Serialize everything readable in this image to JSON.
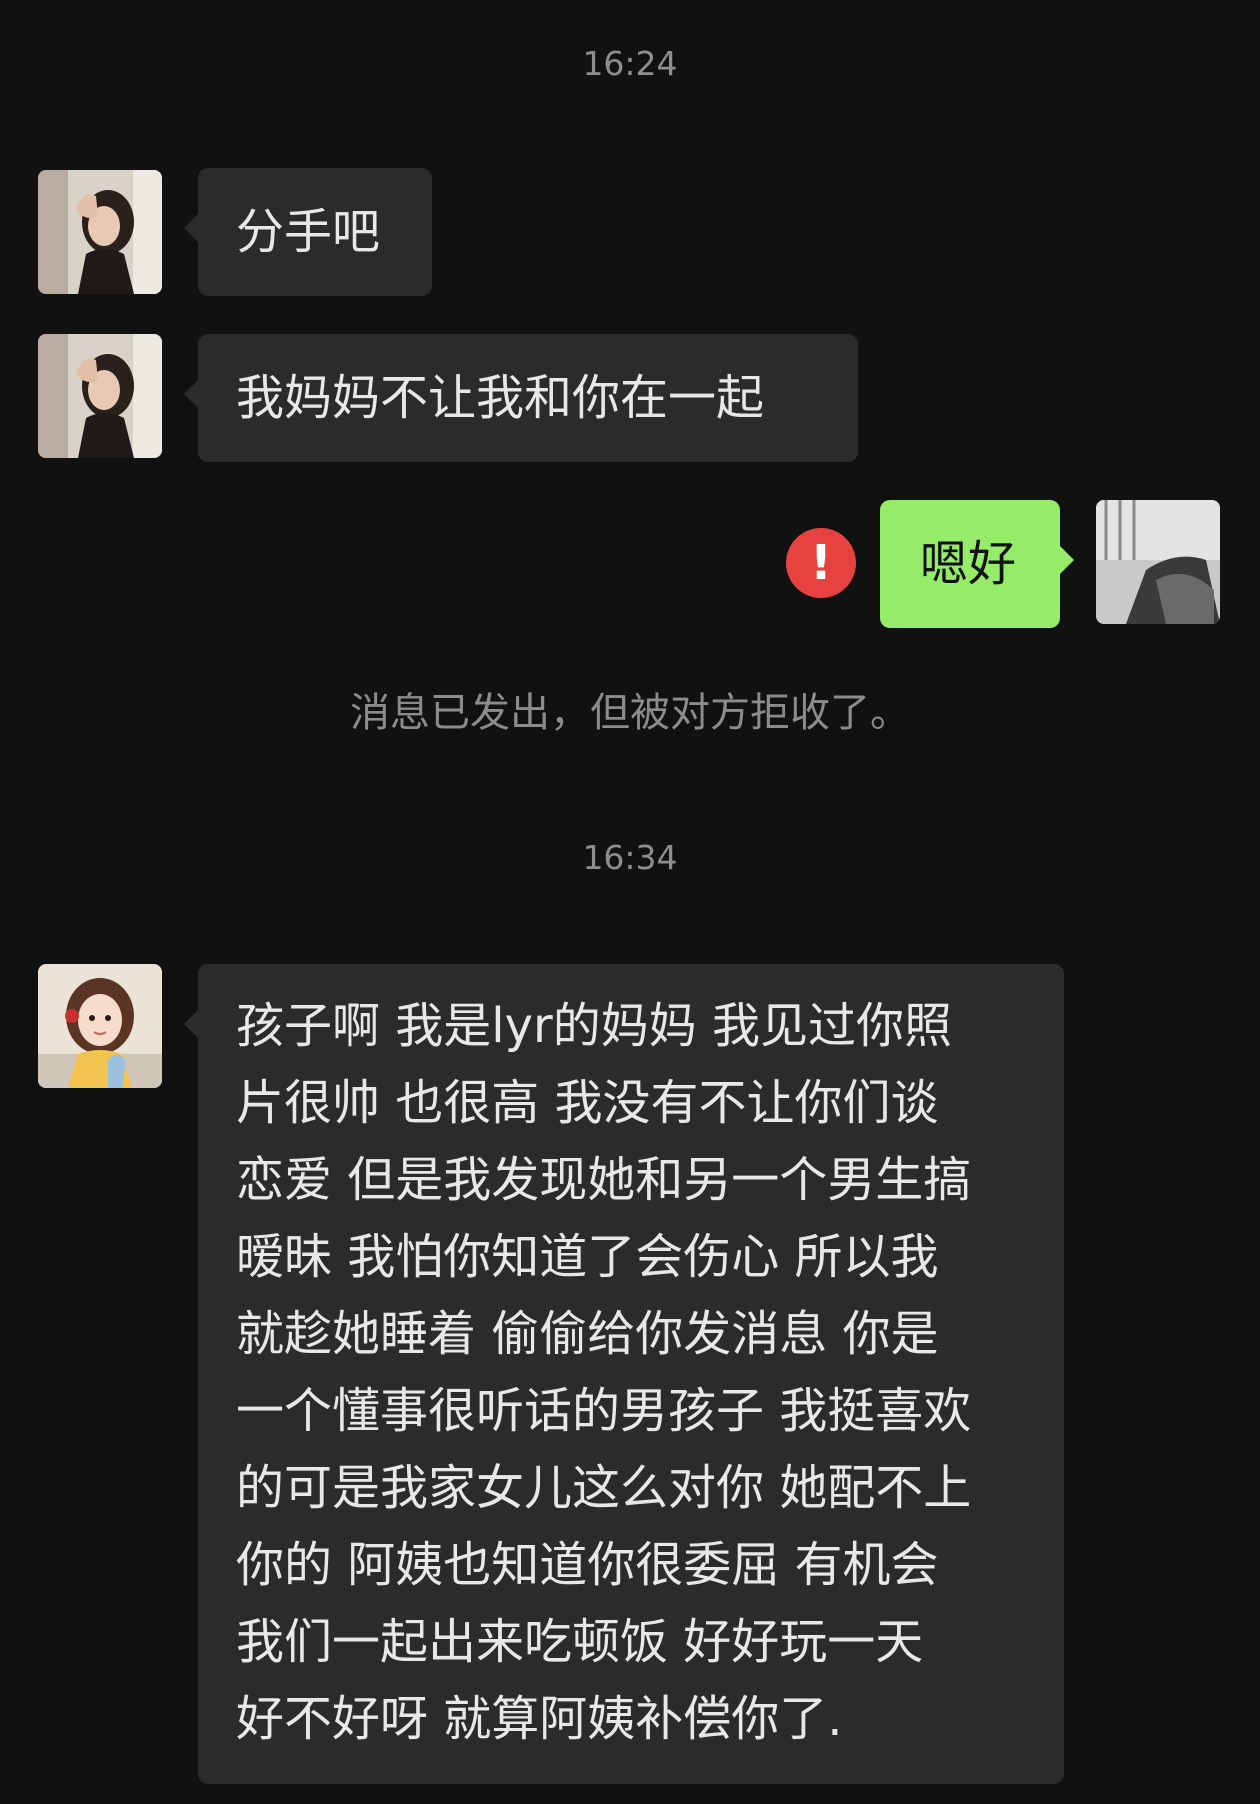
{
  "timestamps": [
    "16:24",
    "16:34"
  ],
  "messages": [
    {
      "sender": "girlfriend",
      "text": "分手吧"
    },
    {
      "sender": "girlfriend",
      "text": "我妈妈不让我和你在一起"
    },
    {
      "sender": "me",
      "text": "嗯好",
      "status": "rejected"
    },
    {
      "sender": "mother",
      "text": "孩子啊 我是lyr的妈妈 我见过你照\n片很帅 也很高 我没有不让你们谈\n恋爱 但是我发现她和另一个男生搞\n暧昧 我怕你知道了会伤心 所以我\n就趁她睡着 偷偷给你发消息 你是\n一个懂事很听话的男孩子 我挺喜欢\n的可是我家女儿这么对你 她配不上\n你的 阿姨也知道你很委屈 有机会\n我们一起出来吃顿饭 好好玩一天\n好不好呀 就算阿姨补偿你了."
    }
  ],
  "system_notice": "消息已发出，但被对方拒收了。",
  "error_symbol": "!",
  "colors": {
    "background": "#111111",
    "incoming_bubble": "#2b2b2b",
    "outgoing_bubble": "#95ec69",
    "error": "#e64340"
  }
}
